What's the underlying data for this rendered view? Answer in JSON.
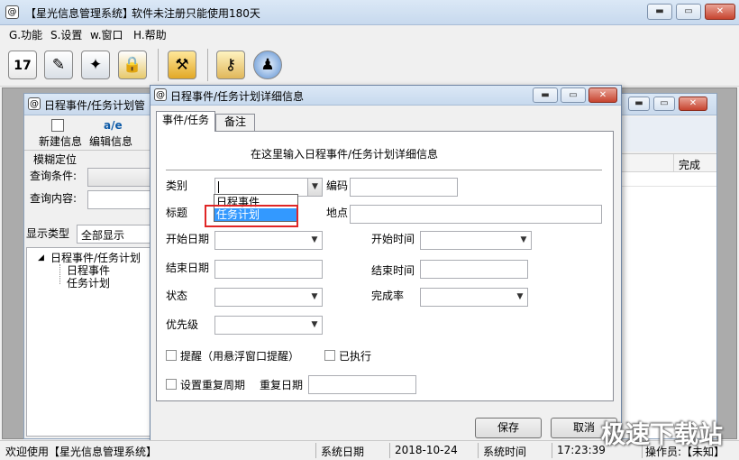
{
  "app": {
    "title_name": "【星光信息管理系统】",
    "title_note": "软件未注册只能使用180天"
  },
  "menu": [
    "G.功能",
    "S.设置",
    "w.窗口",
    "H.帮助"
  ],
  "toolbar": {
    "icons": [
      "calendar-icon",
      "pen-icon",
      "compass-icon",
      "lock-icon",
      "tools-icon",
      "keys-icon",
      "tie-person-icon"
    ],
    "calendar_day": "17"
  },
  "child_window": {
    "title": "日程事件/任务计划管",
    "new_label": "新建信息",
    "edit_label": "编辑信息",
    "fuzzy_group": "模糊定位",
    "query_condition_label": "查询条件:",
    "query_content_label": "查询内容:",
    "display_type_label": "显示类型",
    "display_type_value": "全部显示",
    "tree": {
      "root": "日程事件/任务计划",
      "children": [
        "日程事件",
        "任务计划"
      ]
    },
    "column_complete": "完成"
  },
  "dialog": {
    "title": "日程事件/任务计划详细信息",
    "tabs": [
      "事件/任务",
      "备注"
    ],
    "heading": "在这里输入日程事件/任务计划详细信息",
    "labels": {
      "category": "类别",
      "code": "编码",
      "title": "标题",
      "location": "地点",
      "start_date": "开始日期",
      "start_time": "开始时间",
      "end_date": "结束日期",
      "end_time": "结束时间",
      "status": "状态",
      "completion": "完成率",
      "priority": "优先级",
      "remind": "提醒（用悬浮窗口提醒）",
      "executed": "已执行",
      "repeat": "设置重复周期",
      "repeat_date": "重复日期"
    },
    "category_options": [
      "日程事件",
      "任务计划"
    ],
    "category_highlighted": "任务计划",
    "save_label": "保存",
    "cancel_label": "取消"
  },
  "status_bar": {
    "welcome": "欢迎使用【星光信息管理系统】",
    "date_label": "系统日期",
    "date_value": "2018-10-24",
    "time_label": "系统时间",
    "time_value": "17:23:39",
    "operator_label": "操作员:【未知】"
  },
  "watermark": "极速下载站"
}
